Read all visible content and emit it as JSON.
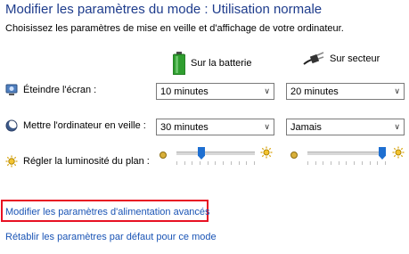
{
  "header": {
    "title": "Modifier les paramètres du mode : Utilisation normale",
    "subtitle": "Choisissez les paramètres de mise en veille et d'affichage de votre ordinateur."
  },
  "columns": {
    "battery": "Sur la batterie",
    "plugged": "Sur secteur"
  },
  "rows": {
    "display": {
      "label": "Éteindre l'écran :",
      "battery_value": "10 minutes",
      "plugged_value": "20 minutes"
    },
    "sleep": {
      "label": "Mettre l'ordinateur en veille :",
      "battery_value": "30 minutes",
      "plugged_value": "Jamais"
    },
    "brightness": {
      "label": "Régler la luminosité du plan :",
      "battery_level": 0.3,
      "plugged_level": 1.0
    }
  },
  "links": {
    "advanced": "Modifier les paramètres d'alimentation avancés",
    "restore": "Rétablir les paramètres par défaut pour ce mode"
  },
  "colors": {
    "title": "#1e3c8c",
    "link": "#1a54b5",
    "highlight_box": "#e81123",
    "slider_thumb": "#1e6fd1"
  }
}
